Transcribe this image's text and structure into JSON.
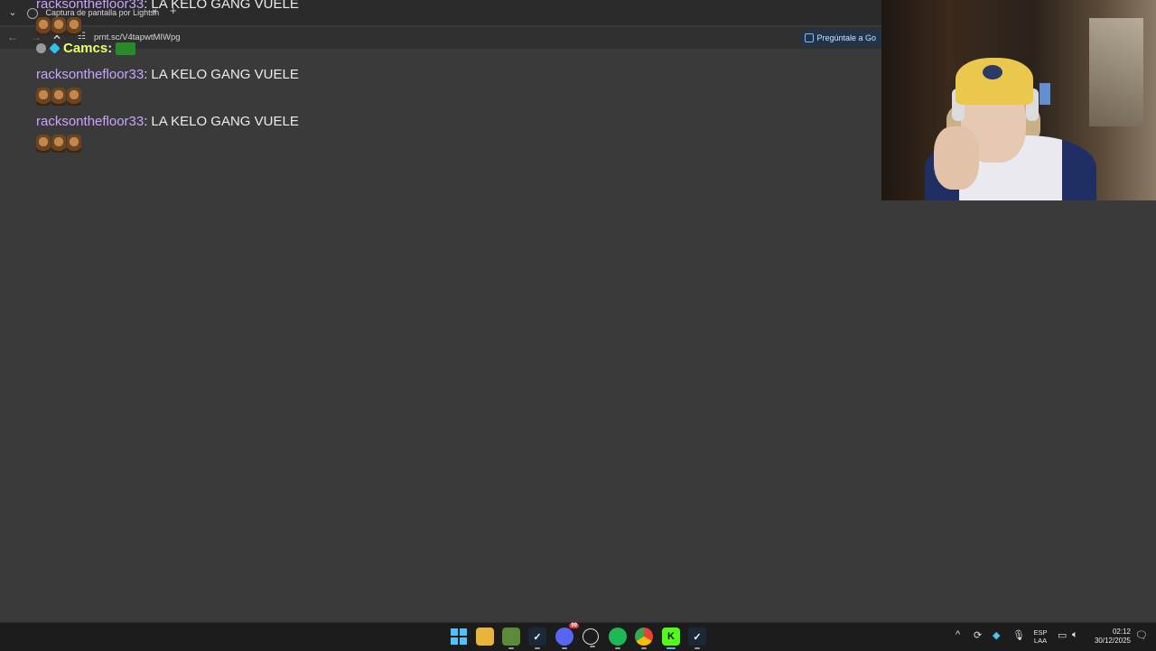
{
  "browser": {
    "tab_title": "Captura de pantalla por Lightsh",
    "tab_close": "×",
    "new_tab": "+",
    "url": "prnt.sc/V4tapwtMIWpg",
    "ask_google": "Pregúntale a Go"
  },
  "chat": {
    "messages": [
      {
        "user": "racksonthefloor33",
        "sep": ":",
        "text": "LA KELO GANG VUELE"
      },
      {
        "user": "racksonthefloor33",
        "sep": ":",
        "text": "LA KELO GANG VUELE"
      },
      {
        "user": "racksonthefloor33",
        "sep": ":",
        "text": "LA KELO GANG VUELE"
      }
    ],
    "camcs": {
      "user": "Camcs",
      "sep": ":"
    }
  },
  "taskbar": {
    "apps": [
      "windows-start",
      "file-explorer",
      "minecraft",
      "steam",
      "discord",
      "obs",
      "spotify",
      "chrome",
      "kick",
      "steam-2"
    ],
    "discord_badge": "99",
    "tray_chevron": "^",
    "lang_line1": "ESP",
    "lang_line2": "LAA",
    "time": "02:12",
    "date": "30/12/2025"
  },
  "colors": {
    "username": "#c9a4ff",
    "camcs": "#e9ff6b",
    "background": "#3a3a3a",
    "taskbar": "#1c1c1c"
  }
}
